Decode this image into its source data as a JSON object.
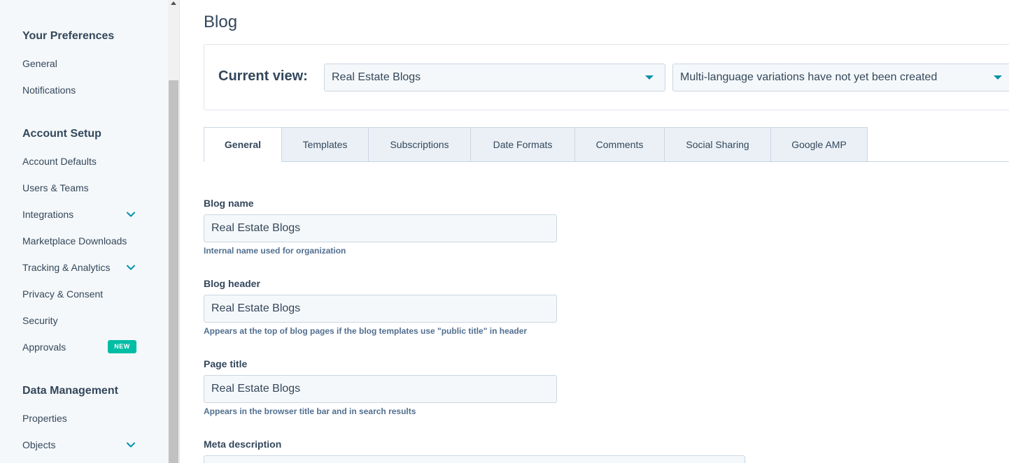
{
  "sidebar": {
    "sections": [
      {
        "heading": "Your Preferences",
        "items": [
          {
            "label": "General"
          },
          {
            "label": "Notifications"
          }
        ]
      },
      {
        "heading": "Account Setup",
        "items": [
          {
            "label": "Account Defaults"
          },
          {
            "label": "Users & Teams"
          },
          {
            "label": "Integrations",
            "expandable": true
          },
          {
            "label": "Marketplace Downloads"
          },
          {
            "label": "Tracking & Analytics",
            "expandable": true
          },
          {
            "label": "Privacy & Consent"
          },
          {
            "label": "Security"
          },
          {
            "label": "Approvals",
            "badge": "NEW"
          }
        ]
      },
      {
        "heading": "Data Management",
        "items": [
          {
            "label": "Properties"
          },
          {
            "label": "Objects",
            "expandable": true
          }
        ]
      }
    ],
    "chevron_icon": "chevron-down-icon",
    "badge_color": "#00bda5"
  },
  "page": {
    "title": "Blog",
    "current_view_label": "Current view:",
    "blog_select": "Real Estate Blogs",
    "language_select": "Multi-language variations have not yet been created",
    "accent_color": "#0091ae"
  },
  "tabs": [
    {
      "label": "General",
      "active": true
    },
    {
      "label": "Templates"
    },
    {
      "label": "Subscriptions"
    },
    {
      "label": "Date Formats"
    },
    {
      "label": "Comments"
    },
    {
      "label": "Social Sharing"
    },
    {
      "label": "Google AMP"
    }
  ],
  "form": {
    "blog_name": {
      "label": "Blog name",
      "value": "Real Estate Blogs",
      "help": "Internal name used for organization"
    },
    "blog_header": {
      "label": "Blog header",
      "value": "Real Estate Blogs",
      "help": "Appears at the top of blog pages if the blog templates use \"public title\" in header"
    },
    "page_title": {
      "label": "Page title",
      "value": "Real Estate Blogs",
      "help": "Appears in the browser title bar and in search results"
    },
    "meta_description": {
      "label": "Meta description",
      "value": ""
    }
  }
}
